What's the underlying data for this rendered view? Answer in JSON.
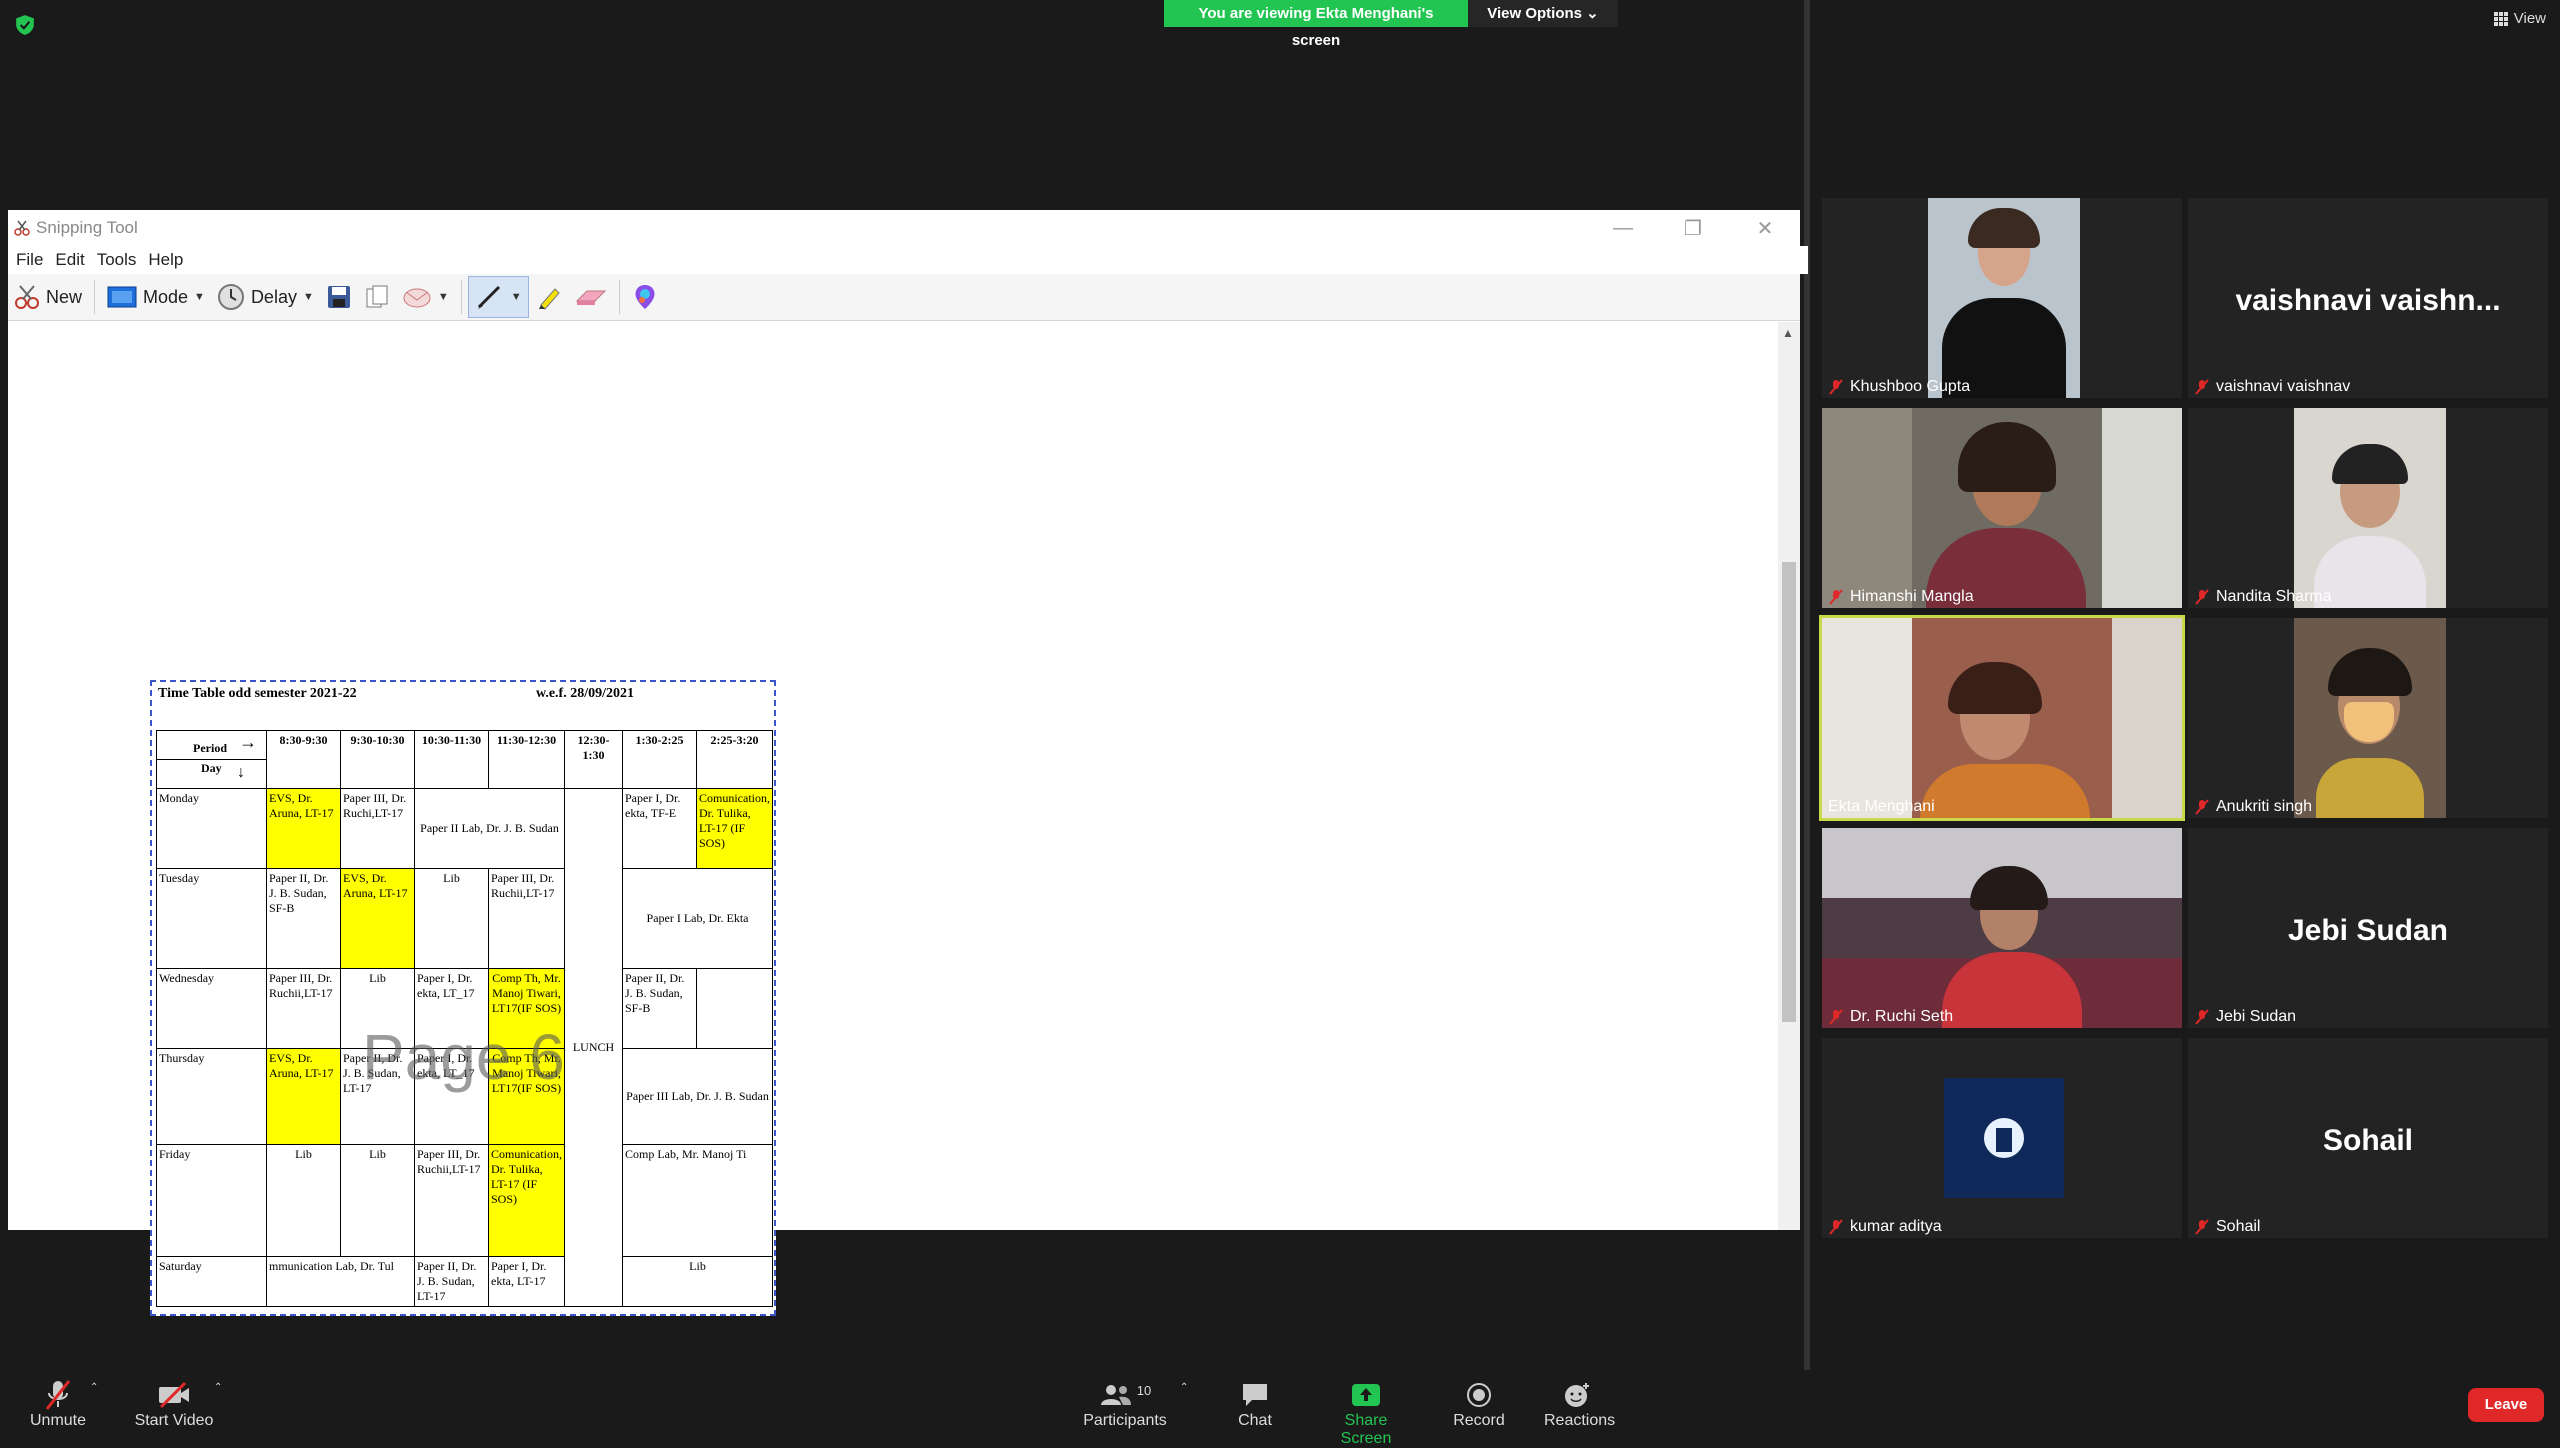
{
  "banner": {
    "viewing_label": "You are viewing Ekta Menghani's screen",
    "view_options_label": "View Options ⌄",
    "view_label": "View"
  },
  "snipping_tool": {
    "title": "Snipping Tool",
    "menu": [
      "File",
      "Edit",
      "Tools",
      "Help"
    ],
    "toolbar": {
      "new_label": "New",
      "mode_label": "Mode",
      "delay_label": "Delay"
    }
  },
  "timetable": {
    "title": "Time Table odd semester 2021-22",
    "wef": "w.e.f. 28/09/2021",
    "header": {
      "period": "Period",
      "day": "Day"
    },
    "periods": [
      "8:30-9:30",
      "9:30-10:30",
      "10:30-11:30",
      "11:30-12:30",
      "12:30-1:30",
      "1:30-2:25",
      "2:25-3:20"
    ],
    "lunch": "LUNCH",
    "watermark": "Page 6",
    "rows": {
      "monday": {
        "day": "Monday",
        "p1": "EVS, Dr. Aruna, LT-17",
        "p2": "Paper III, Dr. Ruchi,LT-17",
        "p34": "Paper II Lab, Dr. J. B. Sudan",
        "p6": "Paper I, Dr. ekta, TF-E",
        "p7": "Comunication, Dr. Tulika, LT-17 (IF SOS)"
      },
      "tuesday": {
        "day": "Tuesday",
        "p1": "Paper II, Dr. J. B. Sudan, SF-B",
        "p2": "EVS, Dr. Aruna, LT-17",
        "p3": "Lib",
        "p4": "Paper III, Dr. Ruchii,LT-17",
        "p67": "Paper I Lab, Dr. Ekta"
      },
      "wednesday": {
        "day": "Wednesday",
        "p1": "Paper III, Dr. Ruchii,LT-17",
        "p2": "Lib",
        "p3": "Paper I, Dr. ekta, LT_17",
        "p4": "Comp Th, Mr. Manoj Tiwari, LT17(IF SOS)",
        "p6": "Paper II, Dr. J. B. Sudan, SF-B"
      },
      "thursday": {
        "day": "Thursday",
        "p1": "EVS, Dr. Aruna, LT-17",
        "p2": "Paper II, Dr. J. B. Sudan, LT-17",
        "p3": "Paper I, Dr. ekta, LT_17",
        "p4": "Comp Th, Mr. Manoj Tiwari, LT17(IF SOS)",
        "p67": "Paper III Lab, Dr. J. B. Sudan"
      },
      "friday": {
        "day": "Friday",
        "p1": "Lib",
        "p2": "Lib",
        "p3": "Paper III, Dr. Ruchii,LT-17",
        "p4": "Comunication, Dr. Tulika, LT-17 (IF SOS)",
        "p67": "Comp Lab, Mr. Manoj Ti"
      },
      "saturday": {
        "day": "Saturday",
        "p12": "mmunication Lab, Dr. Tul",
        "p3": "Paper II, Dr. J. B. Sudan, LT-17",
        "p4": "Paper I, Dr. ekta, LT-17",
        "p67": "Lib"
      }
    }
  },
  "participants": [
    {
      "name": "Khushboo Gupta",
      "video": true
    },
    {
      "name": "vaishnavi vaishnav",
      "display_name": "vaishnavi  vaishn...",
      "video": false
    },
    {
      "name": "Himanshi Mangla",
      "video": true
    },
    {
      "name": "Nandita Sharma",
      "video": true
    },
    {
      "name": "Ekta Menghani",
      "video": true,
      "active_speaker": true
    },
    {
      "name": "Anukriti singh",
      "video": true
    },
    {
      "name": "Dr. Ruchi Seth",
      "video": true
    },
    {
      "name": "Jebi Sudan",
      "display_name": "Jebi Sudan",
      "video": false
    },
    {
      "name": "kumar aditya",
      "video": false
    },
    {
      "name": "Sohail",
      "display_name": "Sohail",
      "video": false
    }
  ],
  "bottom_bar": {
    "unmute": "Unmute",
    "start_video": "Start Video",
    "participants": "Participants",
    "participants_count": "10",
    "chat": "Chat",
    "share_screen": "Share Screen",
    "record": "Record",
    "reactions": "Reactions",
    "leave": "Leave"
  },
  "colors": {
    "share_green": "#23c552",
    "leave_red": "#e02828",
    "highlight_yellow": "#ffff00",
    "active_speaker": "#c8d94a"
  }
}
